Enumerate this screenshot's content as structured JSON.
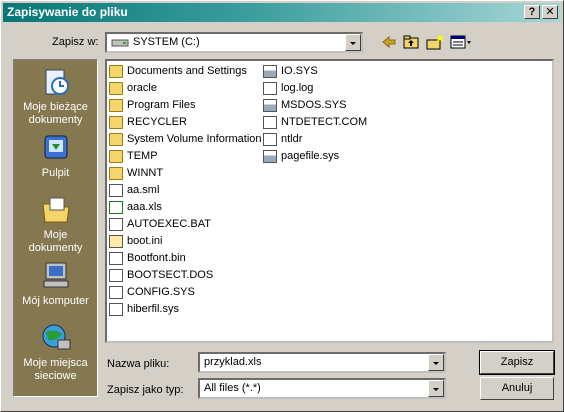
{
  "window": {
    "title": "Zapisywanie do pliku",
    "help_label": "?",
    "close_label": "✕"
  },
  "save_in": {
    "label": "Zapisz w:",
    "value": "SYSTEM (C:)"
  },
  "toolbar": {
    "back_icon": "back-arrow-icon",
    "up_icon": "up-folder-icon",
    "new_folder_icon": "new-folder-icon",
    "views_icon": "views-menu-icon"
  },
  "places": [
    {
      "label": "Moje bieżące\ndokumenty",
      "icon": "recent-documents-icon"
    },
    {
      "label": "Pulpit",
      "icon": "desktop-icon"
    },
    {
      "label": "Moje\ndokumenty",
      "icon": "my-documents-icon"
    },
    {
      "label": "Mój komputer",
      "icon": "my-computer-icon"
    },
    {
      "label": "Moje miejsca\nsieciowe",
      "icon": "network-places-icon"
    }
  ],
  "files_col1": [
    {
      "name": "Documents and Settings",
      "type": "folder"
    },
    {
      "name": "oracle",
      "type": "folder"
    },
    {
      "name": "Program Files",
      "type": "folder"
    },
    {
      "name": "RECYCLER",
      "type": "folder"
    },
    {
      "name": "System Volume Information",
      "type": "folder"
    },
    {
      "name": "TEMP",
      "type": "folder"
    },
    {
      "name": "WINNT",
      "type": "folder"
    },
    {
      "name": "aa.sml",
      "type": "doc"
    },
    {
      "name": "aaa.xls",
      "type": "xls"
    },
    {
      "name": "AUTOEXEC.BAT",
      "type": "doc"
    },
    {
      "name": "boot.ini",
      "type": "ini"
    },
    {
      "name": "Bootfont.bin",
      "type": "doc"
    },
    {
      "name": "BOOTSECT.DOS",
      "type": "doc"
    },
    {
      "name": "CONFIG.SYS",
      "type": "doc"
    },
    {
      "name": "hiberfil.sys",
      "type": "doc"
    }
  ],
  "files_col2": [
    {
      "name": "IO.SYS",
      "type": "sys"
    },
    {
      "name": "log.log",
      "type": "doc"
    },
    {
      "name": "MSDOS.SYS",
      "type": "sys"
    },
    {
      "name": "NTDETECT.COM",
      "type": "doc"
    },
    {
      "name": "ntldr",
      "type": "doc"
    },
    {
      "name": "pagefile.sys",
      "type": "sys"
    }
  ],
  "filename": {
    "label": "Nazwa pliku:",
    "value": "przyklad.xls"
  },
  "filetype": {
    "label": "Zapisz jako typ:",
    "value": "All files (*.*)"
  },
  "buttons": {
    "save": "Zapisz",
    "cancel": "Anuluj"
  }
}
